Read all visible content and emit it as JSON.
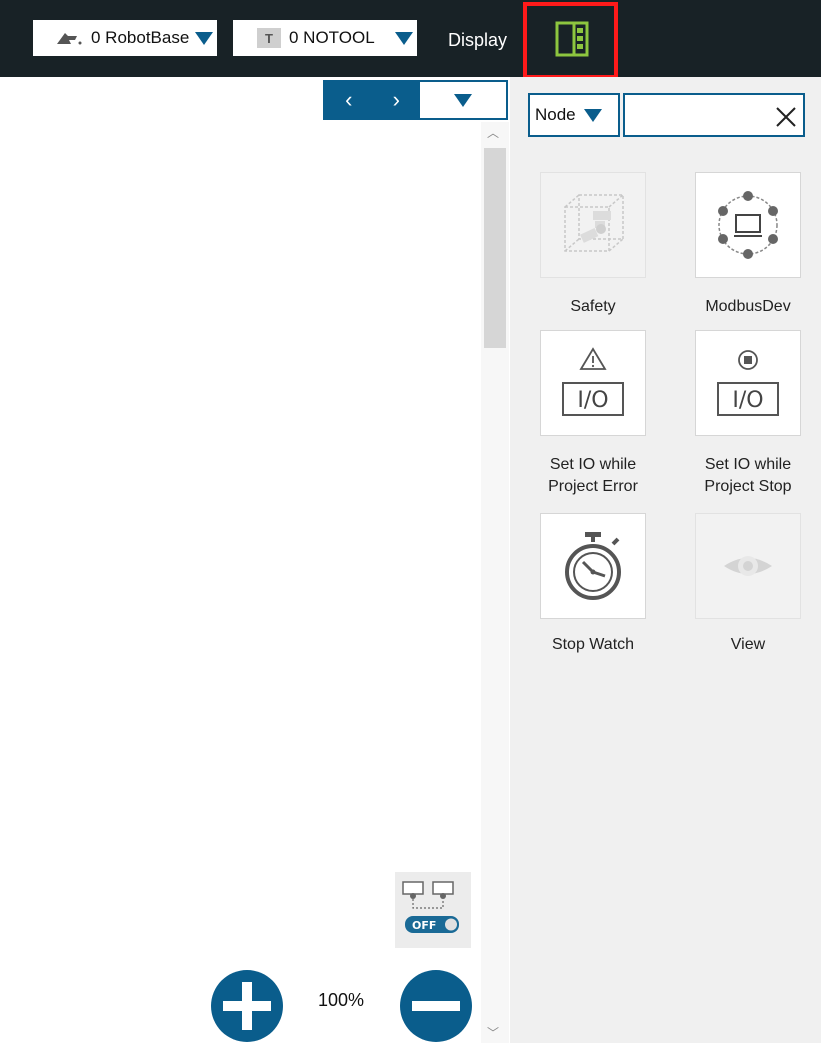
{
  "topbar": {
    "robot_base": "0 RobotBase",
    "tool": "0 NOTOOL",
    "tool_badge": "T",
    "display_label": "Display"
  },
  "search_panel": {
    "filter_value": "Node",
    "search_value": "",
    "search_placeholder": ""
  },
  "nodes": [
    {
      "label": "Safety",
      "icon": "safety-icon",
      "enabled": false
    },
    {
      "label": "ModbusDev",
      "icon": "modbus-device-icon",
      "enabled": true
    },
    {
      "label": "Set IO while Project Error",
      "icon": "io-error-icon",
      "enabled": true
    },
    {
      "label": "Set IO while Project Stop",
      "icon": "io-stop-icon",
      "enabled": true
    },
    {
      "label": "Stop Watch",
      "icon": "stopwatch-icon",
      "enabled": true
    },
    {
      "label": "View",
      "icon": "eye-icon",
      "enabled": false
    }
  ],
  "io_text": "I/O",
  "canvas": {
    "toggle_state": "OFF",
    "zoom_level": "100%"
  },
  "colors": {
    "accent": "#0a5d8c",
    "topbar": "#182226",
    "highlight": "#ff1a1a",
    "display_icon": "#8dc63f"
  }
}
